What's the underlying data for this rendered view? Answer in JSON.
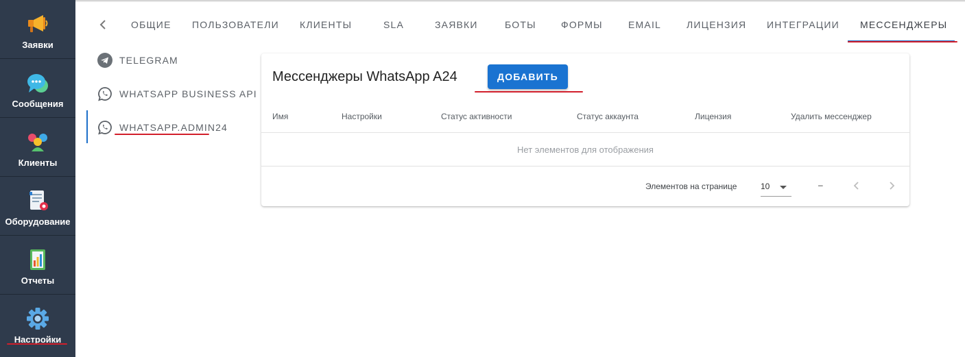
{
  "sidebar": {
    "items": [
      {
        "label": "Заявки",
        "icon": "megaphone-icon"
      },
      {
        "label": "Сообщения",
        "icon": "chat-bubble-icon"
      },
      {
        "label": "Клиенты",
        "icon": "people-icon"
      },
      {
        "label": "Оборудование",
        "icon": "equipment-document-icon"
      },
      {
        "label": "Отчеты",
        "icon": "report-chart-icon"
      },
      {
        "label": "Настройки",
        "icon": "gear-icon"
      }
    ]
  },
  "tabs": {
    "back_icon": "chevron-left-icon",
    "items": [
      {
        "label": "ОБЩИЕ"
      },
      {
        "label": "ПОЛЬЗОВАТЕЛИ"
      },
      {
        "label": "КЛИЕНТЫ"
      },
      {
        "label": "SLA"
      },
      {
        "label": "ЗАЯВКИ"
      },
      {
        "label": "БОТЫ"
      },
      {
        "label": "ФОРМЫ"
      },
      {
        "label": "EMAIL"
      },
      {
        "label": "ЛИЦЕНЗИЯ"
      },
      {
        "label": "ИНТЕГРАЦИИ"
      },
      {
        "label": "МЕССЕНДЖЕРЫ"
      }
    ],
    "active": "МЕССЕНДЖЕРЫ"
  },
  "subnav": {
    "items": [
      {
        "label": "TELEGRAM",
        "icon": "telegram-icon"
      },
      {
        "label": "WHATSAPP BUSINESS API",
        "icon": "whatsapp-icon"
      },
      {
        "label": "WHATSAPP.ADMIN24",
        "icon": "whatsapp-icon"
      }
    ],
    "active": "WHATSAPP.ADMIN24"
  },
  "card": {
    "title": "Мессенджеры WhatsApp A24",
    "add_button": "ДОБАВИТЬ",
    "columns": [
      "Имя",
      "Настройки",
      "Статус активности",
      "Статус аккаунта",
      "Лицензия",
      "Удалить мессенджер"
    ],
    "empty_text": "Нет элементов для отображения",
    "pagination": {
      "per_page_label": "Элементов на странице",
      "per_page_value": "10",
      "range": "–"
    }
  },
  "colors": {
    "sidebar_bg": "#2f3b4c",
    "accent_blue": "#1a73d1",
    "annotation_red": "#d21f2b"
  }
}
